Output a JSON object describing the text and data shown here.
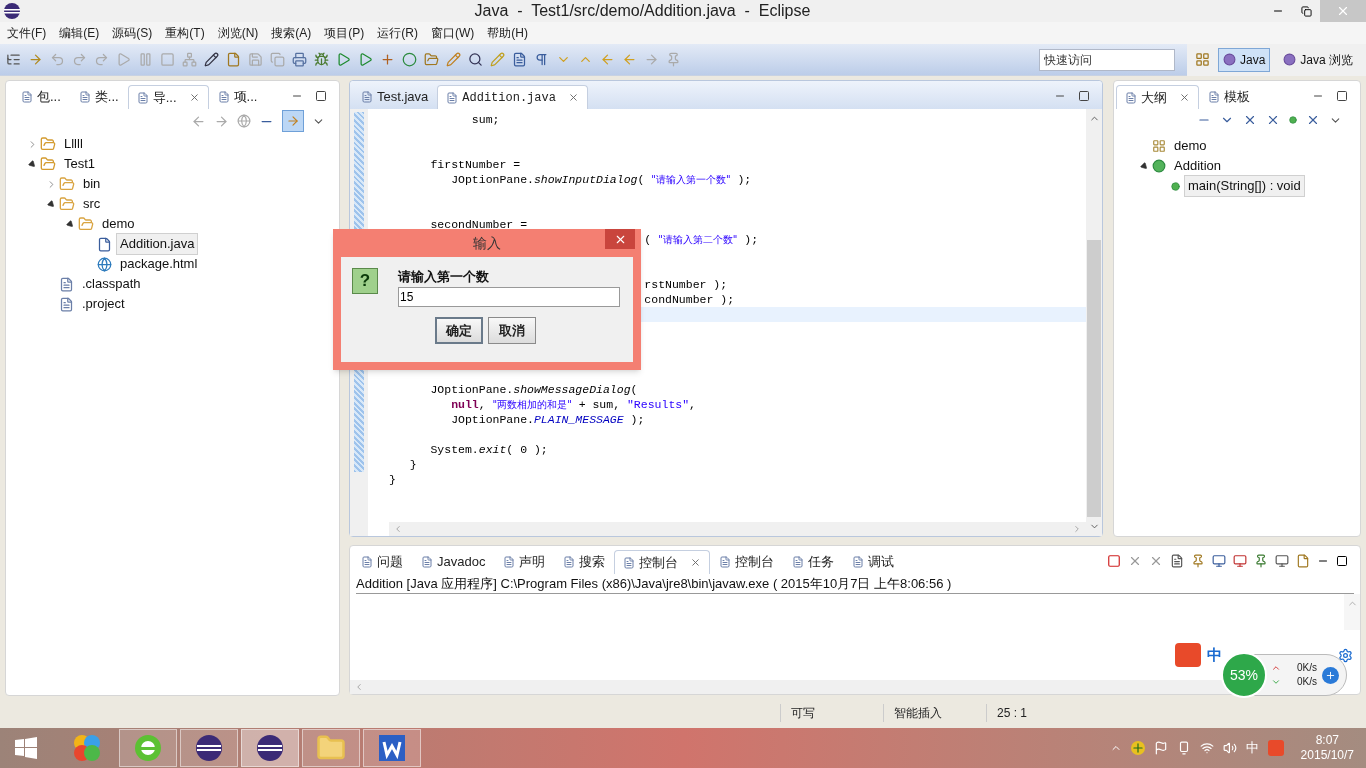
{
  "window": {
    "title": "Java  -  Test1/src/demo/Addition.java  -  Eclipse"
  },
  "menu": [
    "文件(F)",
    "编辑(E)",
    "源码(S)",
    "重构(T)",
    "浏览(N)",
    "搜索(A)",
    "项目(P)",
    "运行(R)",
    "窗口(W)",
    "帮助(H)"
  ],
  "quick_access": {
    "placeholder": "快速访问"
  },
  "perspectives": [
    {
      "label": "Java",
      "selected": true
    },
    {
      "label": "Java 浏览",
      "selected": false
    }
  ],
  "left_panel": {
    "tabs": [
      {
        "label": "包...",
        "selected": false,
        "closable": false
      },
      {
        "label": "类...",
        "selected": false,
        "closable": false
      },
      {
        "label": "导...",
        "selected": true,
        "closable": true
      },
      {
        "label": "项...",
        "selected": false,
        "closable": false
      }
    ],
    "tree": [
      {
        "label": "Lllll",
        "kind": "project",
        "expanded": false,
        "selected": false
      },
      {
        "label": "Test1",
        "kind": "project",
        "expanded": true,
        "selected": false,
        "children": [
          {
            "label": "bin",
            "kind": "folder",
            "expanded": false,
            "selected": false
          },
          {
            "label": "src",
            "kind": "folder",
            "expanded": true,
            "selected": false,
            "children": [
              {
                "label": "demo",
                "kind": "folder",
                "expanded": true,
                "selected": false,
                "children": [
                  {
                    "label": "Addition.java",
                    "kind": "java",
                    "selected": true
                  },
                  {
                    "label": "package.html",
                    "kind": "html",
                    "selected": false
                  }
                ]
              }
            ]
          },
          {
            "label": ".classpath",
            "kind": "file",
            "selected": false
          },
          {
            "label": ".project",
            "kind": "file",
            "selected": false
          }
        ]
      }
    ]
  },
  "editor": {
    "tabs": [
      {
        "label": "Test.java",
        "selected": false,
        "closable": false
      },
      {
        "label": "Addition.java",
        "selected": true,
        "closable": true
      }
    ],
    "lines": [
      {
        "current": false,
        "parts": [
          {
            "text": "            sum;",
            "kind": "plain"
          }
        ]
      },
      {
        "current": false
      },
      {
        "current": false
      },
      {
        "current": false,
        "parts": [
          {
            "text": "      firstNumber =",
            "kind": "plain"
          }
        ]
      },
      {
        "current": false,
        "parts": [
          {
            "text": "         JOptionPane.",
            "kind": "plain"
          },
          {
            "text": "showInputDialog",
            "kind": "method"
          },
          {
            "text": "( ",
            "kind": "plain"
          },
          {
            "text": "\"请输入第一个数\"",
            "kind": "cjk_string"
          },
          {
            "text": " );",
            "kind": "plain"
          }
        ]
      },
      {
        "current": false
      },
      {
        "current": false
      },
      {
        "current": false,
        "parts": [
          {
            "text": "      secondNumber =",
            "kind": "plain"
          }
        ]
      },
      {
        "current": false,
        "parts": [
          {
            "text": "                                     ( ",
            "kind": "plain"
          },
          {
            "text": "\"请输入第二个数\"",
            "kind": "cjk_string"
          },
          {
            "text": " );",
            "kind": "plain"
          }
        ]
      },
      {
        "current": false
      },
      {
        "current": false
      },
      {
        "current": false,
        "parts": [
          {
            "text": "                                     rstNumber );",
            "kind": "plain"
          }
        ]
      },
      {
        "current": false,
        "parts": [
          {
            "text": "                                     condNumber );",
            "kind": "plain"
          }
        ]
      },
      {
        "current": true
      },
      {
        "current": false
      },
      {
        "current": false
      },
      {
        "current": false
      },
      {
        "current": false
      },
      {
        "current": false,
        "parts": [
          {
            "text": "      JOptionPane.",
            "kind": "plain"
          },
          {
            "text": "showMessageDialog",
            "kind": "method"
          },
          {
            "text": "(",
            "kind": "plain"
          }
        ]
      },
      {
        "current": false,
        "parts": [
          {
            "text": "         null",
            "kind": "keyword"
          },
          {
            "text": ", ",
            "kind": "plain"
          },
          {
            "text": "\"两数相加的和是\"",
            "kind": "cjk_string"
          },
          {
            "text": " + sum, ",
            "kind": "plain"
          },
          {
            "text": "\"Results\"",
            "kind": "string"
          },
          {
            "text": ",",
            "kind": "plain"
          }
        ]
      },
      {
        "current": false,
        "parts": [
          {
            "text": "         JOptionPane.",
            "kind": "plain"
          },
          {
            "text": "PLAIN_MESSAGE",
            "kind": "constant"
          },
          {
            "text": " );",
            "kind": "plain"
          }
        ]
      },
      {
        "current": false
      },
      {
        "current": false,
        "parts": [
          {
            "text": "      System.",
            "kind": "plain"
          },
          {
            "text": "exit",
            "kind": "method"
          },
          {
            "text": "( 0 );",
            "kind": "plain"
          }
        ]
      },
      {
        "current": false,
        "parts": [
          {
            "text": "   }",
            "kind": "plain"
          }
        ]
      },
      {
        "current": false,
        "parts": [
          {
            "text": "}",
            "kind": "plain"
          }
        ]
      }
    ]
  },
  "outline_panel": {
    "tabs": [
      {
        "label": "大纲",
        "selected": true,
        "closable": true
      },
      {
        "label": "模板",
        "selected": false,
        "closable": false
      }
    ],
    "tree": [
      {
        "label": "demo",
        "kind": "package",
        "selected": false
      },
      {
        "label": "Addition",
        "kind": "class",
        "expanded": true,
        "selected": false,
        "children": [
          {
            "label": "main(String[]) : void",
            "kind": "method",
            "selected": true
          }
        ]
      }
    ]
  },
  "console": {
    "tabs": [
      {
        "label": "问题",
        "selected": false,
        "closable": false
      },
      {
        "label": "Javadoc",
        "selected": false,
        "closable": false
      },
      {
        "label": "声明",
        "selected": false,
        "closable": false
      },
      {
        "label": "搜索",
        "selected": false,
        "closable": false
      },
      {
        "label": "控制台",
        "selected": true,
        "closable": true
      },
      {
        "label": "控制台",
        "selected": false,
        "closable": false
      },
      {
        "label": "任务",
        "selected": false,
        "closable": false
      },
      {
        "label": "调试",
        "selected": false,
        "closable": false
      }
    ],
    "header": "Addition [Java 应用程序] C:\\Program Files (x86)\\Java\\jre8\\bin\\javaw.exe ( 2015年10月7日 上午8:06:56 )"
  },
  "dialog": {
    "title": "输入",
    "icon_glyph": "?",
    "message": "请输入第一个数",
    "value": "15",
    "buttons": [
      {
        "label": "确定",
        "selected": true
      },
      {
        "label": "取消",
        "selected": false
      }
    ]
  },
  "ime_bar": {
    "mode": "中"
  },
  "net_meter": {
    "percent": "53%",
    "upload": "0K/s",
    "download": "0K/s"
  },
  "status_bar": [
    "可写",
    "智能插入",
    "25 : 1"
  ],
  "taskbar": {
    "apps": [
      {
        "kind": "colorball",
        "running": false,
        "selected": false
      },
      {
        "kind": "browser",
        "running": true,
        "selected": false
      },
      {
        "kind": "eclipse",
        "running": true,
        "selected": false
      },
      {
        "kind": "eclipse",
        "running": true,
        "selected": true
      },
      {
        "kind": "folder",
        "running": true,
        "selected": false
      },
      {
        "kind": "word",
        "running": true,
        "selected": false
      }
    ],
    "ime": "中",
    "time": "8:07",
    "date": "2015/10/7"
  }
}
